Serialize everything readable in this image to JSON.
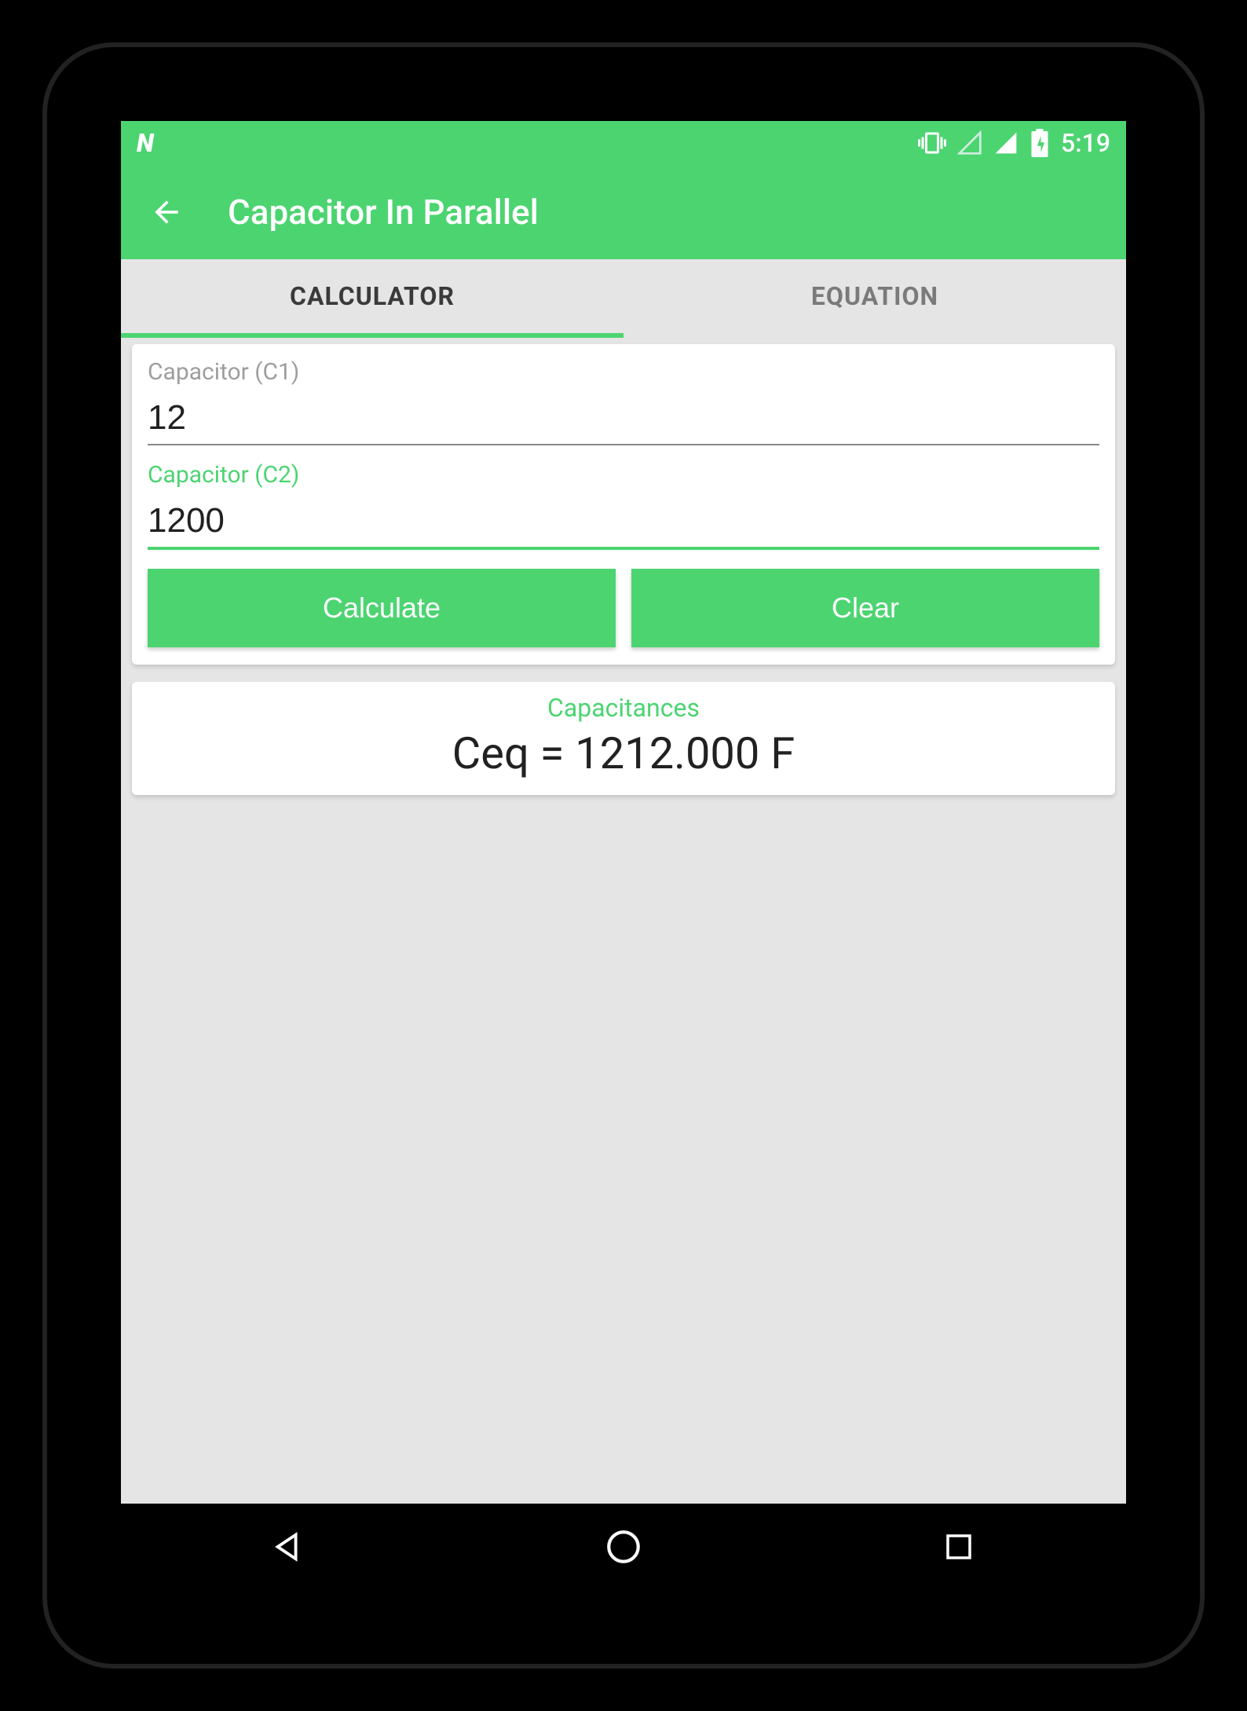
{
  "colors": {
    "accent": "#4cd471"
  },
  "statusbar": {
    "logo": "N",
    "time": "5:19",
    "icons": {
      "vibrate": "vibrate",
      "signal_empty": "signal-empty",
      "signal_full": "signal-full",
      "battery": "battery-charging"
    }
  },
  "appbar": {
    "title": "Capacitor In Parallel",
    "back_icon": "arrow-back"
  },
  "tabs": [
    {
      "label": "CALCULATOR",
      "active": true
    },
    {
      "label": "EQUATION",
      "active": false
    }
  ],
  "inputs": {
    "c1": {
      "label": "Capacitor (C1)",
      "value": "12",
      "focused": false
    },
    "c2": {
      "label": "Capacitor (C2)",
      "value": "1200",
      "focused": true
    }
  },
  "buttons": {
    "calculate": "Calculate",
    "clear": "Clear"
  },
  "result": {
    "label": "Capacitances",
    "value": "Ceq = 1212.000 F"
  },
  "navbar": {
    "back": "triangle-back",
    "home": "circle-home",
    "recent": "square-recent"
  }
}
